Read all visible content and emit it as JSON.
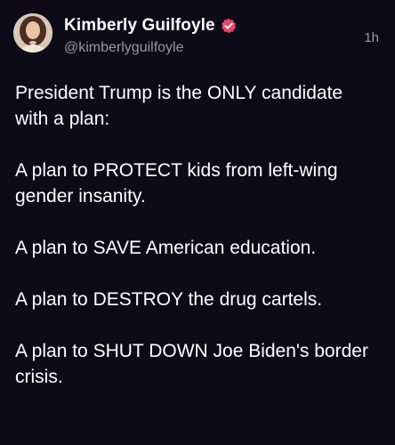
{
  "author": {
    "display_name": "Kimberly Guilfoyle",
    "handle": "@kimberlyguilfoyle",
    "verified_icon": "verified-badge-icon",
    "avatar_icon": "profile-photo"
  },
  "post": {
    "timestamp": "1h",
    "paragraphs": [
      "President Trump is the ONLY candidate with a plan:",
      "A plan to PROTECT kids from left-wing gender insanity.",
      "A plan to SAVE American education.",
      "A plan to DESTROY the drug cartels.",
      "A plan to SHUT DOWN Joe Biden's border crisis."
    ]
  },
  "colors": {
    "background": "#0d0b17",
    "text": "#ffffff",
    "muted": "#9a96a6",
    "verified_badge": "#e8466a"
  }
}
